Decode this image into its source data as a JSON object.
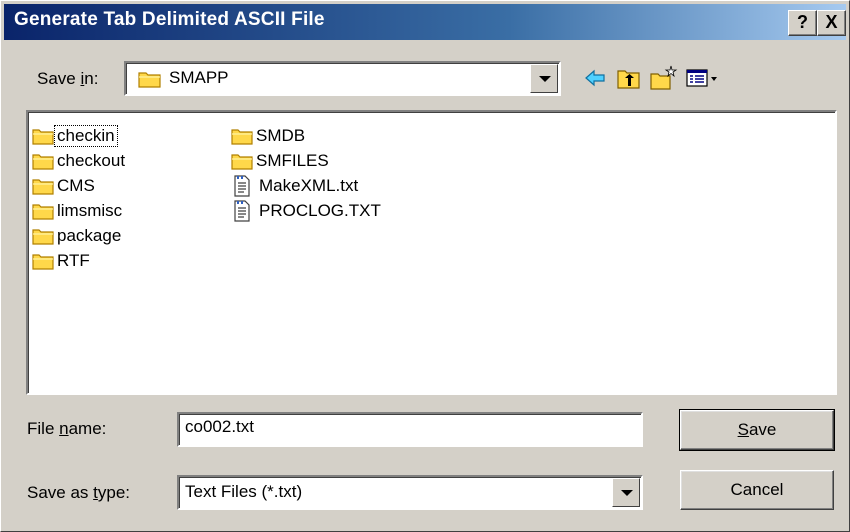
{
  "window": {
    "title": "Generate Tab Delimited ASCII File",
    "help_label": "?",
    "close_label": "X"
  },
  "save_in": {
    "label_prefix": "Save ",
    "label_accel": "i",
    "label_suffix": "n:",
    "value": "SMAPP",
    "icon": "folder-icon"
  },
  "toolbar": {
    "back_icon": "back-arrow-icon",
    "up_icon": "up-one-level-icon",
    "new_folder_icon": "new-folder-icon",
    "view_icon": "view-menu-icon"
  },
  "files": {
    "column1": [
      {
        "name": "checkin",
        "type": "folder"
      },
      {
        "name": "checkout",
        "type": "folder"
      },
      {
        "name": "CMS",
        "type": "folder"
      },
      {
        "name": "limsmisc",
        "type": "folder"
      },
      {
        "name": "package",
        "type": "folder"
      },
      {
        "name": "RTF",
        "type": "folder"
      }
    ],
    "column2": [
      {
        "name": "SMDB",
        "type": "folder"
      },
      {
        "name": "SMFILES",
        "type": "folder"
      },
      {
        "name": "MakeXML.txt",
        "type": "file"
      },
      {
        "name": "PROCLOG.TXT",
        "type": "file"
      }
    ]
  },
  "file_name": {
    "label_prefix": "File ",
    "label_accel": "n",
    "label_suffix": "ame:",
    "value": "co002.txt"
  },
  "save_as_type": {
    "label_prefix": "Save as ",
    "label_accel": "t",
    "label_suffix": "ype:",
    "value": "Text Files (*.txt)"
  },
  "buttons": {
    "save_accel": "S",
    "save_rest": "ave",
    "cancel": "Cancel"
  },
  "colors": {
    "title_start": "#0a246a",
    "title_end": "#a6caf0",
    "face": "#d4d0c8",
    "folder": "#ffd84a"
  }
}
